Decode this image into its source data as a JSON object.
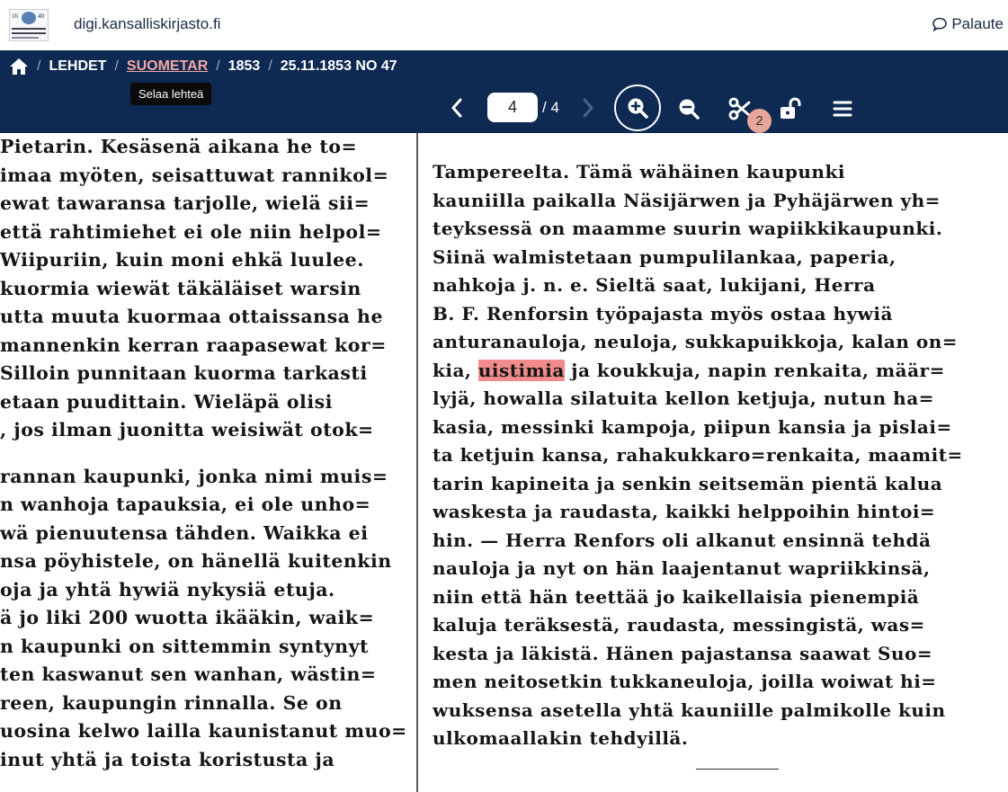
{
  "header": {
    "site_name": "digi.kansalliskirjasto.fi",
    "feedback_label": "Palaute",
    "logo": {
      "year_left": "16",
      "year_right": "40"
    }
  },
  "breadcrumb": {
    "home_icon": "home-icon",
    "items": [
      "LEHDET",
      "SUOMETAR",
      "1853",
      "25.11.1853 NO 47"
    ],
    "tooltip": "Selaa lehteä"
  },
  "toolbar": {
    "current_page": "4",
    "total_pages": "/ 4",
    "clip_count": "2",
    "icons": [
      "chevron-left-icon",
      "chevron-right-icon",
      "zoom-in-icon",
      "zoom-out-icon",
      "scissors-icon",
      "unlock-icon",
      "menu-icon"
    ]
  },
  "colors": {
    "nav_bg": "#0e2a52",
    "highlight": "#f07878",
    "badge": "#e8a69b",
    "link_active": "#f4a7a2"
  },
  "document": {
    "left_lines": [
      "Pietarin. Kesäsenä aikana he to=",
      "imaa myöten, seisattuwat rannikol=",
      "ewat tawaransa tarjolle, wielä sii=",
      "että rahtimiehet ei ole niin helpol=",
      "Wiipuriin, kuin moni ehkä luulee.",
      "kuormia wiewät täkäläiset warsin",
      "utta muuta kuormaa ottaissansa he",
      "mannenkin kerran raapasewat kor=",
      "Silloin punnitaan kuorma tarkasti",
      "etaan puudittain. Wieläpä olisi",
      ", jos ilman juonitta weisiwät otok=",
      "",
      "rannan kaupunki, jonka nimi muis=",
      "n wanhoja tapauksia, ei ole unho=",
      "wä pienuutensa tähden. Waikka ei",
      "nsa pöyhistele, on hänellä kuitenkin",
      "oja ja yhtä hywiä nykysiä etuja.",
      "ä jo liki 200 wuotta ikääkin, waik=",
      "n kaupunki on sittemmin syntynyt",
      "ten kaswanut sen wanhan, wästin=",
      "reen, kaupungin rinnalla. Se on",
      "uosina kelwo lailla kaunistanut muo=",
      "inut yhtä ja toista koristusta ja"
    ],
    "right_lines": [
      "Tampereelta. Tämä wähäinen kaupunki",
      "kauniilla paikalla Näsijärwen ja Pyhäjärwen yh=",
      "teyksessä on maamme suurin wapiikkikaupunki.",
      "Siinä walmistetaan pumpulilankaa, paperia,",
      "nahkoja j. n. e. Sieltä saat, lukijani, Herra",
      "B. F. Renforsin työpajasta myös ostaa hywiä",
      "anturanauloja, neuloja, sukkapuikkoja, kalan on=",
      "kia, |uistimia| ja koukkuja, napin renkaita, määr=",
      "lyjä, howalla silatuita kellon ketjuja, nutun ha=",
      "kasia, messinki kampoja, piipun kansia ja pislai=",
      "ta ketjuin kansa, rahakukkaro=renkaita, maamit=",
      "tarin kapineita ja senkin seitsemän pientä kalua",
      "waskesta ja raudasta, kaikki helppoihin hintoi=",
      "hin. — Herra Renfors oli alkanut ensinnä tehdä",
      "nauloja ja nyt on hän laajentanut wapriikkinsä,",
      "niin että hän teettää jo kaikellaisia pienempiä",
      "kaluja teräksestä, raudasta, messingistä, was=",
      "kesta ja läkistä. Hänen pajastansa saawat Suo=",
      "men neitosetkin tukkaneuloja, joilla woiwat hi=",
      "wuksensa asetella yhtä kauniille palmikolle kuin",
      "ulkomaallakin tehdyillä."
    ]
  }
}
